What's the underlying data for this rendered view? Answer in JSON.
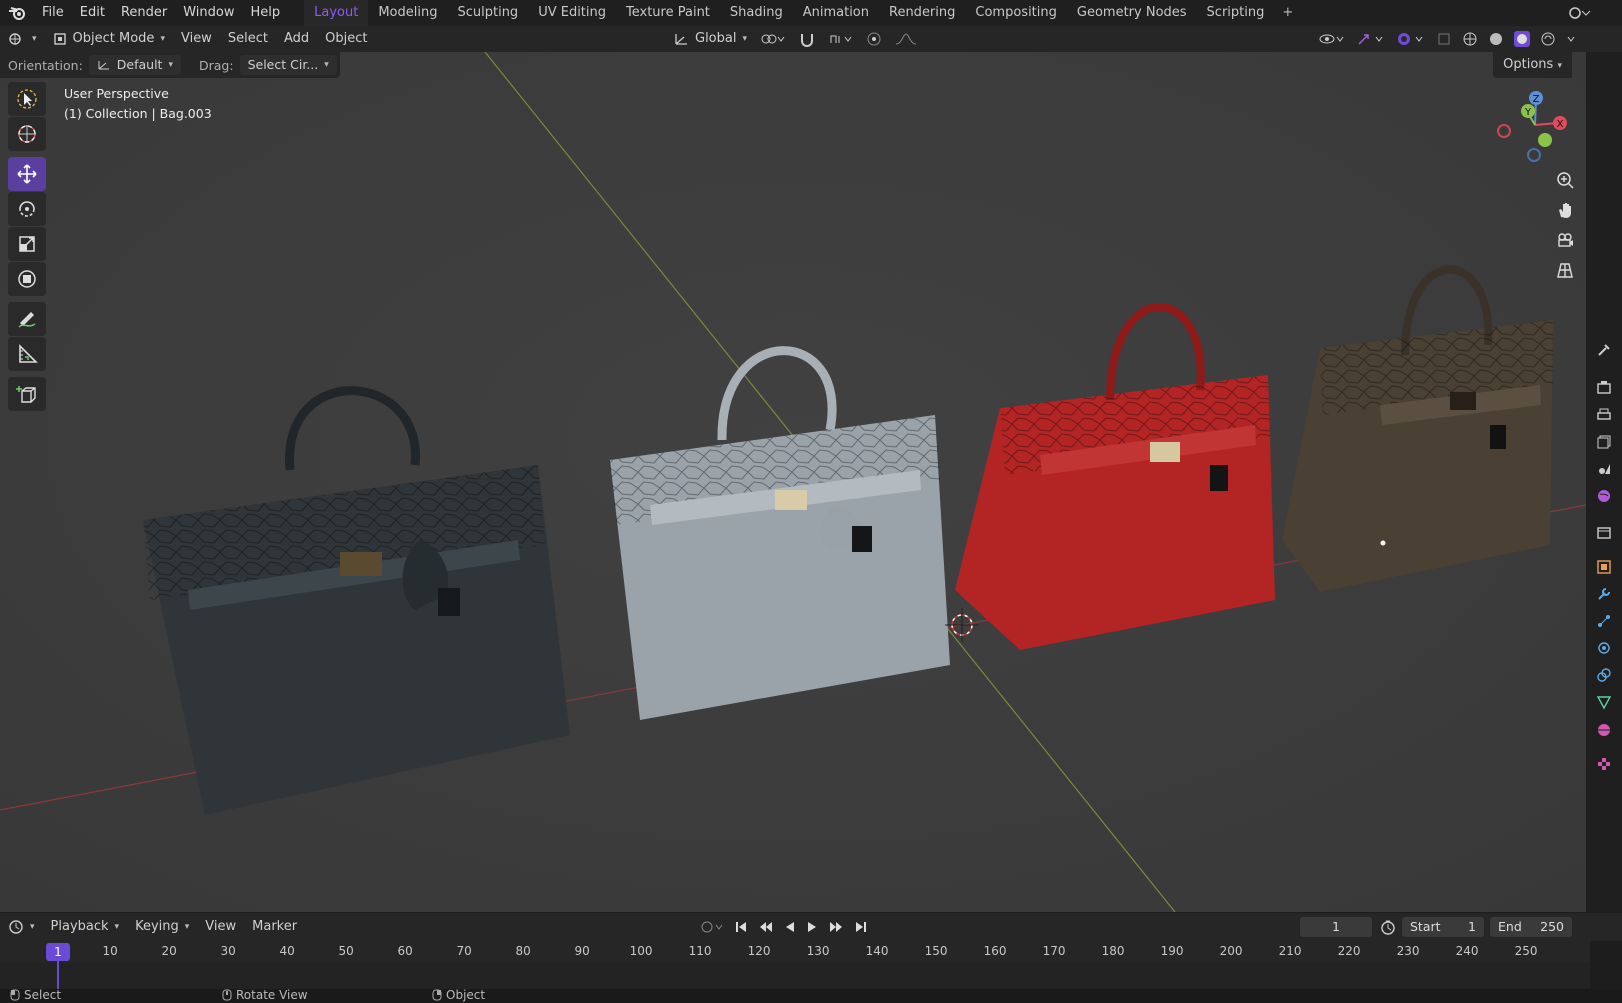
{
  "menubar": {
    "items": [
      "File",
      "Edit",
      "Render",
      "Window",
      "Help"
    ],
    "workspaces": [
      "Layout",
      "Modeling",
      "Sculpting",
      "UV Editing",
      "Texture Paint",
      "Shading",
      "Animation",
      "Rendering",
      "Compositing",
      "Geometry Nodes",
      "Scripting"
    ],
    "active_workspace": "Layout",
    "add_icon": "plus"
  },
  "header": {
    "editor_type_icon": "3d-viewport-icon",
    "mode": "Object Mode",
    "menus": [
      "View",
      "Select",
      "Add",
      "Object"
    ],
    "transform_orientation": "Global"
  },
  "tool_settings": {
    "orientation_label": "Orientation:",
    "orientation_value": "Default",
    "drag_label": "Drag:",
    "drag_value": "Select Cir...",
    "options_label": "Options"
  },
  "viewport": {
    "perspective_label": "User Perspective",
    "collection_label": "(1) Collection | Bag.003",
    "background_color": "#3d3d3d",
    "objects": [
      {
        "color": "#2f3538"
      },
      {
        "color": "#9aa3aa"
      },
      {
        "color": "#b32424"
      },
      {
        "color": "#4a4034"
      }
    ],
    "gizmo_axes": [
      "Z",
      "Y",
      "X"
    ],
    "axis_colors": {
      "x": "#e04c5c",
      "y": "#8bc34a",
      "z": "#5f8fd6"
    }
  },
  "toolbar": {
    "tools": [
      "select-box-icon",
      "cursor-icon",
      "move-icon",
      "rotate-icon",
      "scale-icon",
      "transform-icon",
      "annotate-icon",
      "measure-icon",
      "add-cube-icon"
    ],
    "active_tool": "move-icon",
    "accent": "#5a3fa0"
  },
  "timeline": {
    "menus": [
      "Playback",
      "Keying",
      "View",
      "Marker"
    ],
    "current_frame": "1",
    "start_label": "Start",
    "start_value": "1",
    "end_label": "End",
    "end_value": "250",
    "ruler_labels": [
      "10",
      "20",
      "30",
      "40",
      "50",
      "60",
      "70",
      "80",
      "90",
      "100",
      "110",
      "120",
      "130",
      "140",
      "150",
      "160",
      "170",
      "180",
      "190",
      "200",
      "210",
      "220",
      "230",
      "240",
      "250"
    ],
    "playhead_label": "1",
    "accent": "#6a4bd6"
  },
  "statusbar": {
    "items": [
      "Select",
      "Rotate View",
      "Object"
    ]
  }
}
